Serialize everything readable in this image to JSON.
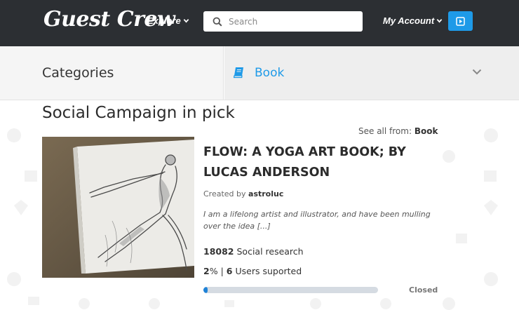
{
  "header": {
    "logo": "Guest Crew",
    "explore_label": "Explore",
    "search_placeholder": "Search",
    "account_label": "My Account"
  },
  "categories": {
    "title": "Categories",
    "selected": "Book"
  },
  "section": {
    "title": "Social Campaign in pick",
    "see_all_prefix": "See all from:",
    "see_all_category": "Book"
  },
  "project": {
    "title": "FLOW: A YOGA ART BOOK; BY LUCAS ANDERSON",
    "created_prefix": "Created by",
    "creator": "astroluc",
    "blurb": "I am a lifelong artist and illustrator, and have been mulling over the idea [...]",
    "research_count": "18082",
    "research_label": "Social research",
    "percent": "2",
    "percent_sign": "%",
    "separator": "|",
    "users_count": "6",
    "users_label": "Users suported",
    "progress_fraction": 0.02,
    "status": "Closed"
  },
  "colors": {
    "header_bg": "#2c2f33",
    "accent": "#1e9ae8",
    "progress_fill": "#1e82d7",
    "progress_track": "#d5dbe2"
  },
  "icons": [
    "chevron-down-icon",
    "search-icon",
    "play-icon",
    "book-icon"
  ]
}
